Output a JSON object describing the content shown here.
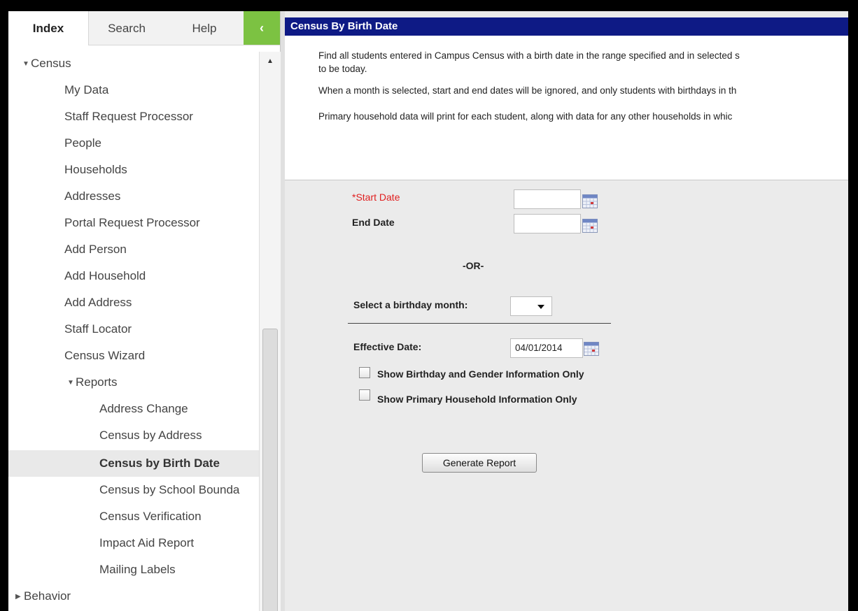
{
  "tabs": [
    {
      "label": "Index"
    },
    {
      "label": "Search"
    },
    {
      "label": "Help"
    }
  ],
  "collapse_glyph": "‹",
  "tree": {
    "census_label": "Census",
    "items": [
      "My Data",
      "Staff Request Processor",
      "People",
      "Households",
      "Addresses",
      "Portal Request Processor",
      "Add Person",
      "Add Household",
      "Add Address",
      "Staff Locator",
      "Census Wizard"
    ],
    "reports_label": "Reports",
    "report_items": [
      "Address Change",
      "Census by Address",
      "Census by Birth Date",
      "Census by School Bounda",
      "Census Verification",
      "Impact Aid Report",
      "Mailing Labels"
    ],
    "selected": "Census by Birth Date",
    "behavior_label": "Behavior"
  },
  "panel": {
    "title": "Census By Birth Date",
    "desc_1a": "Find all students entered in Campus Census with a birth date in the range specified and in selected s",
    "desc_1b": "to be today.",
    "desc_2": "When a month is selected, start and end dates will be ignored, and only students with birthdays in th",
    "desc_3": "Primary household data will print for each student, along with data for any other households in whic"
  },
  "form": {
    "start_date_label": "*Start Date",
    "start_date_value": "",
    "end_date_label": "End Date",
    "end_date_value": "",
    "or_label": "-OR-",
    "month_label": "Select a birthday month:",
    "month_value": "",
    "effective_label": "Effective Date:",
    "effective_value": "04/01/2014",
    "cb1_label": "Show Birthday and Gender Information Only",
    "cb2_label": "Show Primary Household Information Only",
    "generate_label": "Generate Report"
  },
  "colors": {
    "title_bar": "#0e1a85",
    "collapse_green": "#7cc242",
    "required_red": "#e02020"
  }
}
